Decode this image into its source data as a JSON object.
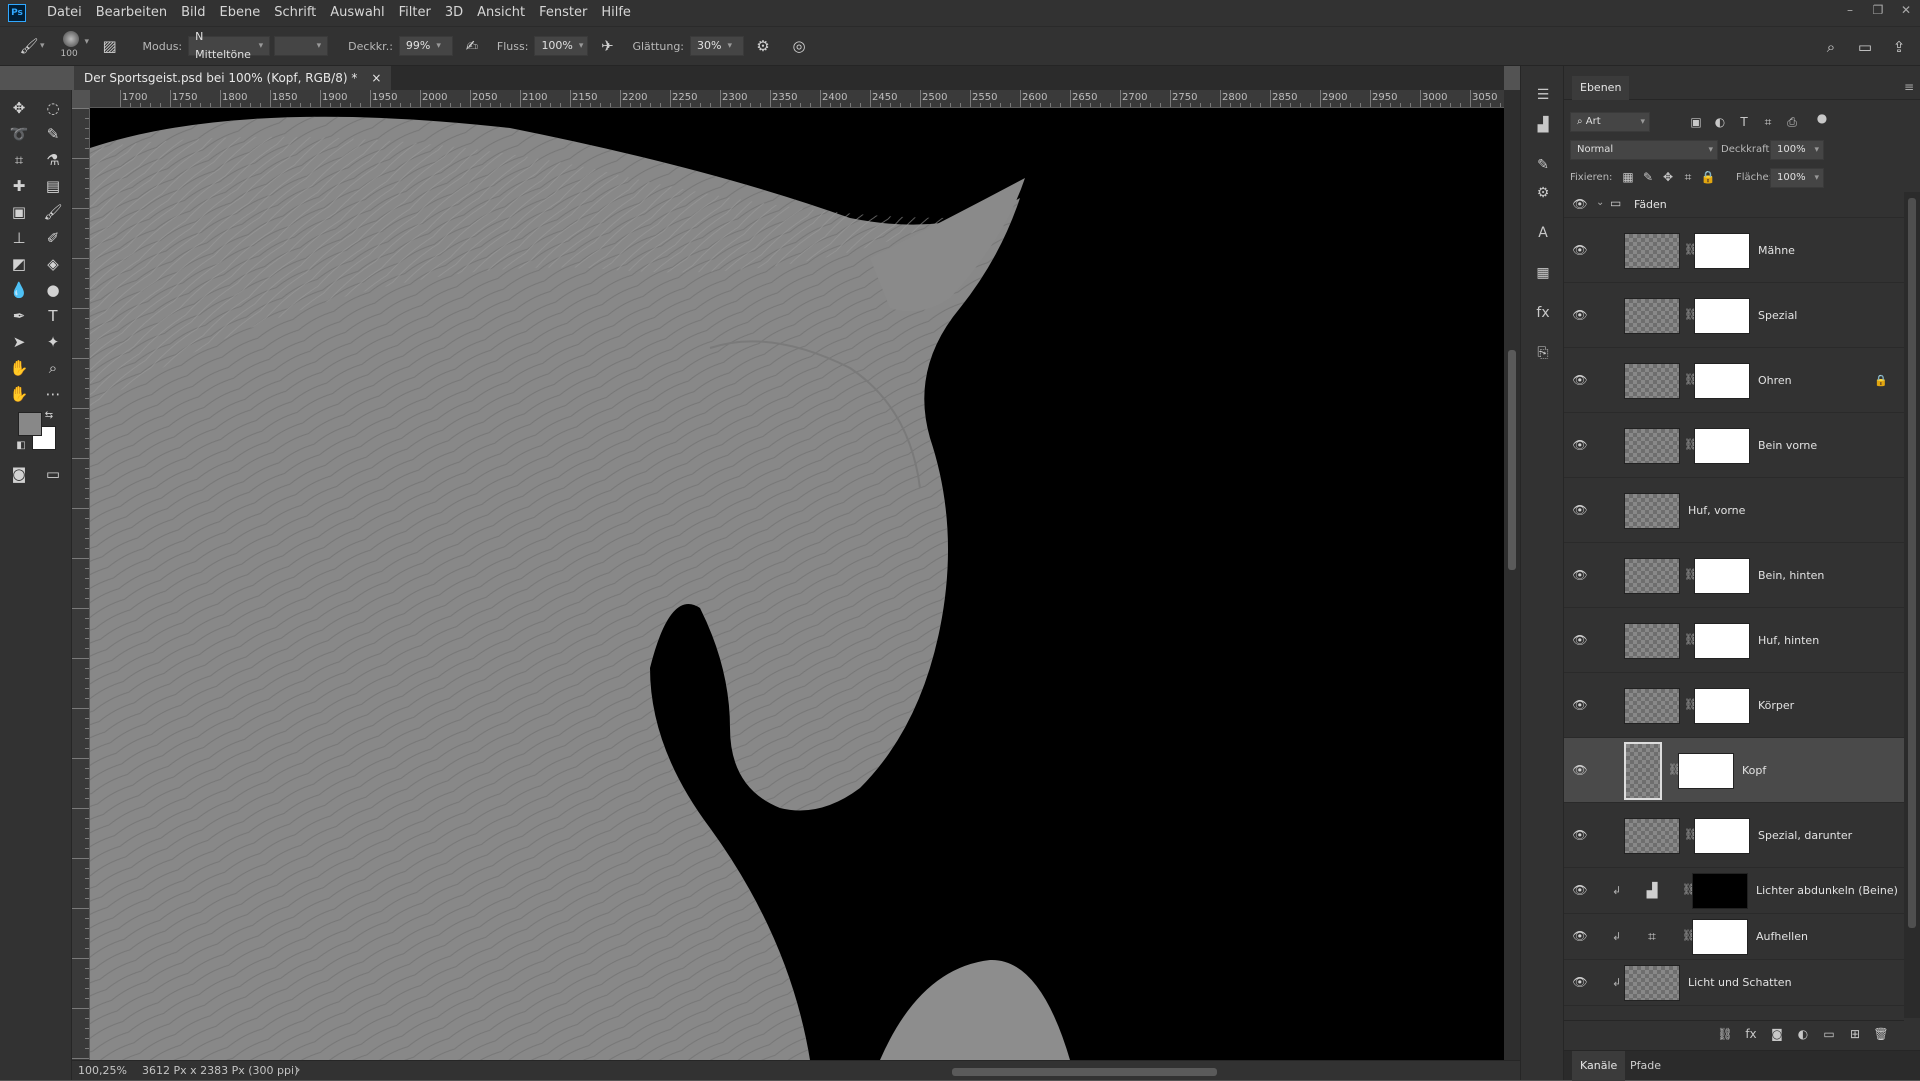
{
  "app": {
    "logo": "Ps"
  },
  "menu": [
    "Datei",
    "Bearbeiten",
    "Bild",
    "Ebene",
    "Schrift",
    "Auswahl",
    "Filter",
    "3D",
    "Ansicht",
    "Fenster",
    "Hilfe"
  ],
  "window_controls": {
    "minimize": "–",
    "restore": "❐",
    "close": "✕"
  },
  "options": {
    "brush_size": "100",
    "modus_label": "Modus:",
    "modus_value": "N  Mitteltöne",
    "deckkr_label": "Deckkr.:",
    "deckkr_value": "99%",
    "fluss_label": "Fluss:",
    "fluss_value": "100%",
    "glaettung_label": "Glättung:",
    "glaettung_value": "30%"
  },
  "document_tab": {
    "title": "Der Sportsgeist.psd bei 100% (Kopf, RGB/8) *",
    "close": "×"
  },
  "ruler_top": [
    "1700",
    "1750",
    "1800",
    "1850",
    "1900",
    "1950",
    "2000",
    "2050",
    "2100",
    "2150",
    "2200",
    "2250",
    "2300",
    "2350",
    "2400",
    "2450",
    "2500",
    "2550",
    "2600",
    "2650",
    "2700",
    "2750",
    "2800",
    "2850",
    "2900",
    "2950",
    "3000",
    "3050"
  ],
  "status": {
    "zoom": "100,25%",
    "doc_size": "3612 Px x 2383 Px (300 ppi)",
    "arrow": "›"
  },
  "colors": {
    "foreground": "#888888",
    "background": "#ffffff",
    "horse_gray": "#888888"
  },
  "layers_panel": {
    "tab": "Ebenen",
    "filter_label": "⌕ Art",
    "blend_mode": "Normal",
    "opacity_label": "Deckkraft:",
    "opacity_value": "100%",
    "lock_label": "Fixieren:",
    "fill_label": "Fläche:",
    "fill_value": "100%",
    "group_name": "Fäden",
    "layers": [
      {
        "name": "Mähne",
        "has_mask": true,
        "mask_black": false,
        "locked": false,
        "selected": false,
        "clipped": false,
        "adjustment": ""
      },
      {
        "name": "Spezial",
        "has_mask": true,
        "mask_black": false,
        "locked": false,
        "selected": false,
        "clipped": false,
        "adjustment": ""
      },
      {
        "name": "Ohren",
        "has_mask": true,
        "mask_black": false,
        "locked": true,
        "selected": false,
        "clipped": false,
        "adjustment": ""
      },
      {
        "name": "Bein vorne",
        "has_mask": true,
        "mask_black": false,
        "locked": false,
        "selected": false,
        "clipped": false,
        "adjustment": ""
      },
      {
        "name": "Huf, vorne",
        "has_mask": false,
        "mask_black": false,
        "locked": false,
        "selected": false,
        "clipped": false,
        "adjustment": ""
      },
      {
        "name": "Bein, hinten",
        "has_mask": true,
        "mask_black": false,
        "locked": false,
        "selected": false,
        "clipped": false,
        "adjustment": ""
      },
      {
        "name": "Huf, hinten",
        "has_mask": true,
        "mask_black": false,
        "locked": false,
        "selected": false,
        "clipped": false,
        "adjustment": ""
      },
      {
        "name": "Körper",
        "has_mask": true,
        "mask_black": false,
        "locked": false,
        "selected": false,
        "clipped": false,
        "adjustment": ""
      },
      {
        "name": "Kopf",
        "has_mask": true,
        "mask_black": false,
        "locked": false,
        "selected": true,
        "clipped": false,
        "adjustment": ""
      },
      {
        "name": "Spezial, darunter",
        "has_mask": true,
        "mask_black": false,
        "locked": false,
        "selected": false,
        "clipped": false,
        "adjustment": ""
      },
      {
        "name": "Lichter abdunkeln (Beine)",
        "has_mask": true,
        "mask_black": true,
        "locked": false,
        "selected": false,
        "clipped": true,
        "adjustment": "levels-icon"
      },
      {
        "name": "Aufhellen",
        "has_mask": true,
        "mask_black": false,
        "locked": false,
        "selected": false,
        "clipped": true,
        "adjustment": "curves-icon"
      },
      {
        "name": "Licht und Schatten",
        "has_mask": false,
        "mask_black": false,
        "locked": false,
        "selected": false,
        "clipped": true,
        "adjustment": ""
      }
    ]
  },
  "bottom_tabs": [
    "Kanäle",
    "Pfade"
  ]
}
